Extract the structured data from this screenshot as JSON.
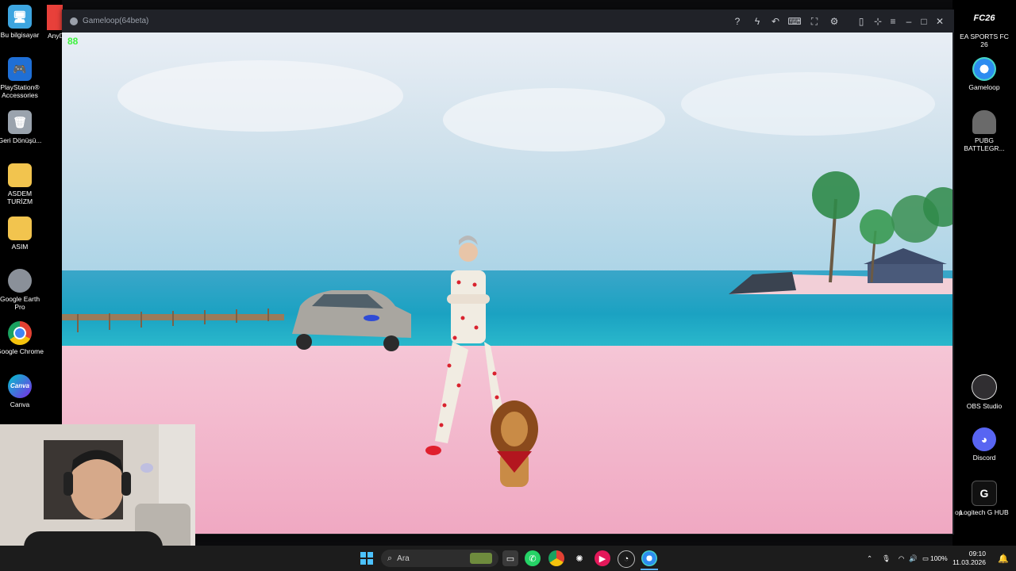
{
  "desktop": {
    "left_icons": [
      {
        "label": "Bu bilgisayar",
        "icon": "monitor-icon",
        "color": "#3da5e0"
      },
      {
        "label": "PlayStation® Accessories",
        "icon": "gamepad-icon",
        "color": "#1f6fd6"
      },
      {
        "label": "Geri Dönüşü...",
        "icon": "recycle-bin-icon",
        "color": "#9aa3ad"
      },
      {
        "label": "ASDEM TURİZM",
        "icon": "folder-icon",
        "color": "#f2c44e"
      },
      {
        "label": "ASIM",
        "icon": "folder-icon",
        "color": "#f2c44e"
      },
      {
        "label": "Google Earth Pro",
        "icon": "earth-icon",
        "color": "#8a9099"
      },
      {
        "label": "Google Chrome",
        "icon": "chrome-icon",
        "color": "#e34133"
      },
      {
        "label": "Canva",
        "icon": "canva-icon",
        "color": "#7d2ae8"
      }
    ],
    "partial_icon_label": "AnyD",
    "right_icons": [
      {
        "label": "EA SPORTS FC 26",
        "icon": "fc26-icon",
        "color": "#ffffff"
      },
      {
        "label": "Gameloop",
        "icon": "gameloop-icon",
        "color": "#2d8cf0"
      },
      {
        "label": "PUBG BATTLEGR...",
        "icon": "pubg-helmet-icon",
        "color": "#6a6a6a"
      },
      {
        "label": "OBS Studio",
        "icon": "obs-icon",
        "color": "#302e31"
      },
      {
        "label": "Discord",
        "icon": "discord-icon",
        "color": "#5865f2"
      },
      {
        "label": "Logitech G HUB",
        "icon": "logitech-g-icon",
        "color": "#111111"
      }
    ],
    "partial_right_label": "op"
  },
  "emulator": {
    "title": "Gameloop(64beta)",
    "toolbar": [
      "help-icon",
      "boost-icon",
      "back-icon",
      "keymap-icon",
      "fullscreen-icon",
      "settings-icon",
      "sidebar-icon",
      "pin-icon",
      "menu-icon",
      "minimize-icon",
      "maximize-icon",
      "close-icon"
    ],
    "fps": "88"
  },
  "taskbar": {
    "search_placeholder": "Ara",
    "apps": [
      "windows-start-icon",
      "task-view-icon",
      "whatsapp-icon",
      "chrome-icon",
      "chatgpt-icon",
      "cast-icon",
      "recorder-icon",
      "gameloop-icon"
    ],
    "battery": "100%",
    "time": "09:10",
    "date": "11.03.2026"
  }
}
